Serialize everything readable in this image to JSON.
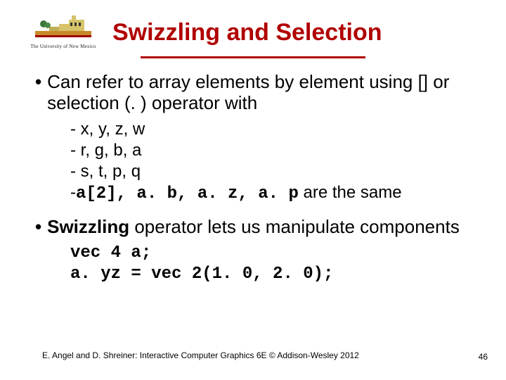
{
  "header": {
    "university": "The University of New Mexico",
    "title": "Swizzling and Selection"
  },
  "bullets": {
    "b1": "Can refer to array elements by element using [] or selection (. ) operator with",
    "sub1": "x, y, z, w",
    "sub2": "r, g, b, a",
    "sub3": "s, t, p, q",
    "sub4_code": "a[2], a. b, a. z, a. p",
    "sub4_tail": " are the same",
    "b2_pre": "Swizzling",
    "b2_post": " operator lets us manipulate components",
    "code1": "vec 4 a;",
    "code2": "a. yz = vec 2(1. 0, 2. 0);"
  },
  "footer": {
    "credit": "E. Angel and D. Shreiner: Interactive Computer Graphics 6E © Addison-Wesley 2012",
    "page": "46"
  }
}
